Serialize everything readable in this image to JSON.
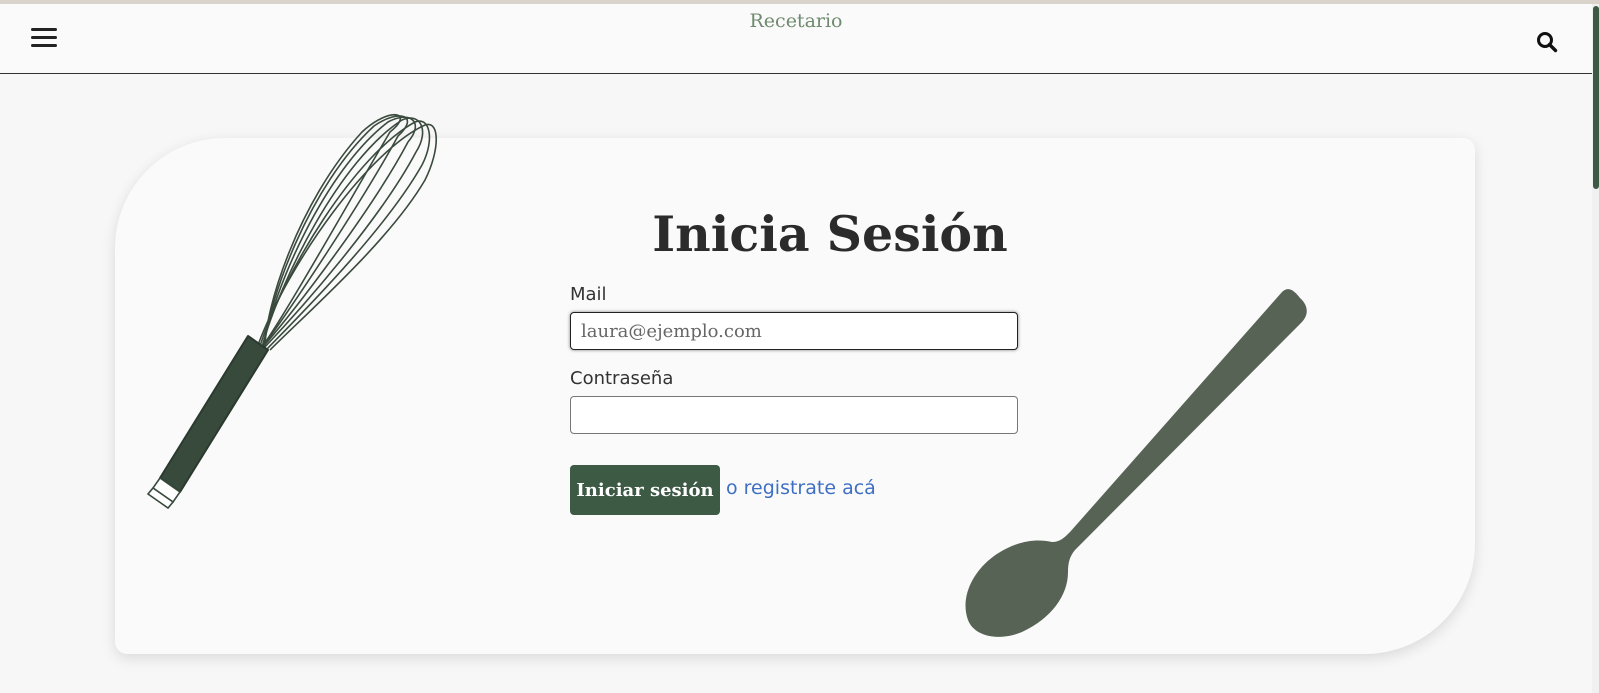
{
  "header": {
    "brand": "Recetario",
    "menu_icon": "hamburger-menu-icon",
    "search_icon": "search-icon"
  },
  "login": {
    "title": "Inicia Sesión",
    "mail_label": "Mail",
    "mail_placeholder": "laura@ejemplo.com",
    "mail_value": "",
    "password_label": "Contraseña",
    "password_value": "",
    "submit_label": "Iniciar sesión",
    "register_link": "o registrate acá"
  },
  "illustrations": {
    "left": "whisk-icon",
    "right": "spoon-icon"
  },
  "colors": {
    "accent": "#3d5a45",
    "brand": "#6f8a6f",
    "link": "#3f6fc4",
    "spoon": "#576355"
  }
}
